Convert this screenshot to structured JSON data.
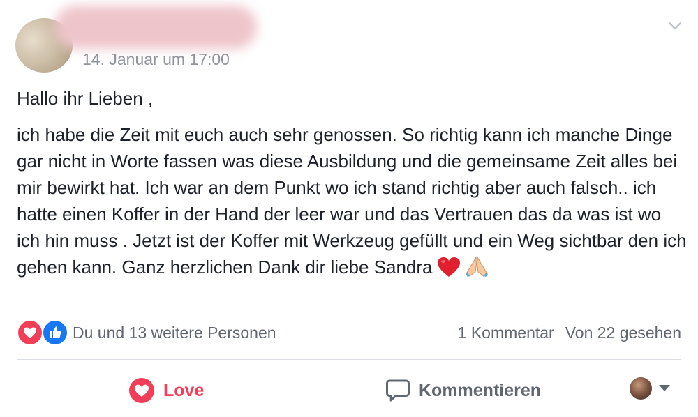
{
  "header": {
    "timestamp": "14. Januar um 17:00"
  },
  "post": {
    "greeting": "Hallo ihr Lieben ,",
    "body": "ich habe die Zeit mit euch auch sehr genossen. So richtig kann ich manche Dinge gar nicht in Worte fassen was diese Ausbildung und die gemeinsame Zeit alles bei mir bewirkt hat. Ich war an dem Punkt wo ich stand richtig aber auch falsch.. ich hatte einen Koffer in der Hand der leer war und das Vertrauen das da was ist wo ich hin muss . Jetzt ist der Koffer mit Werkzeug gefüllt und ein Weg sichtbar den ich gehen kann. Ganz herzlichen Dank dir liebe Sandra"
  },
  "stats": {
    "reactions_text": "Du und 13 weitere Personen",
    "comments_text": "1 Kommentar",
    "views_text": "Von 22 gesehen"
  },
  "actions": {
    "love_label": "Love",
    "comment_label": "Kommentieren"
  },
  "colors": {
    "love": "#f33e58",
    "like": "#1877f2",
    "muted": "#606770",
    "divider": "#dadde1"
  },
  "icons": {
    "chevron": "chevron-down-icon",
    "love_reaction": "love-reaction-icon",
    "like_reaction": "like-reaction-icon",
    "heart_emoji": "red-heart-emoji",
    "pray_emoji": "folded-hands-emoji",
    "love_action": "heart-icon",
    "comment_action": "comment-bubble-icon",
    "dropdown": "caret-down-icon"
  }
}
